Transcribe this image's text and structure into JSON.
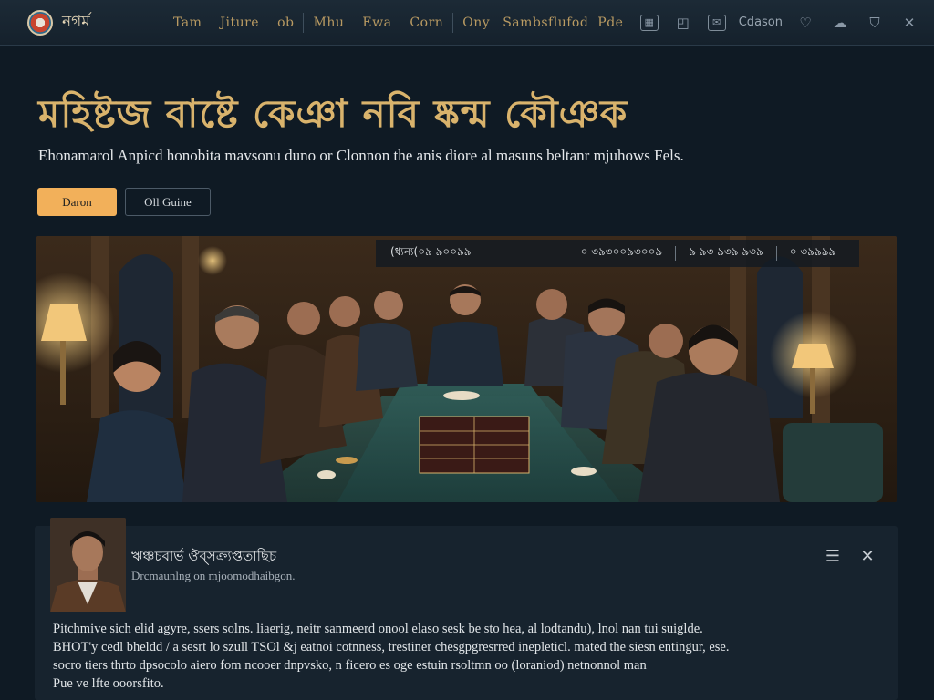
{
  "app": {
    "brand": "নগর্ম"
  },
  "nav": {
    "items": [
      "Tam",
      "Jiture",
      "ob",
      "Mhu",
      "Ewa",
      "Corn",
      "Ony",
      "Sambsflufod",
      "Pde"
    ],
    "right_text": "Cdason"
  },
  "hero": {
    "title": "মহিষ্টজ বাষ্টে কেঞা নবি ষ্কন্ম কৌঞক",
    "subtitle": "Ehonamarol Anpicd honobita mavsonu duno or Clonnon the anis diore al masuns beltanr mjuhows Fels.",
    "primary_button": "Daron",
    "secondary_button": "Oll Guine"
  },
  "scene": {
    "bar_items": [
      "(ধ্যন্য(০৯ ৯০০৯৯",
      "০ ৩৯৩০০৯৩০০৯",
      "৯ ৯৩ ৯৩৯ ৯৩৯",
      "০ ৩৯৯৯৯"
    ]
  },
  "card": {
    "title": "ঋঞ্চচবার্ভ ঔব্সক্র্যপ্ততাছিচ",
    "meta": "Drcmaunlng on mjoomodhaibgon.",
    "body": [
      "Pitchmive sich elid agyre, ssers solns. liaerig, neitr sanmeerd onool elaso sesk be sto hea, al lodtandu), lnol nan tui suiglde.",
      "BHOT'y cedl bheldd / a sesrt lo szull TSOl &j eatnoi cotnness, trestiner chesgpgresrred inepleticl. mated the siesn entingur, ese.",
      "socro tiers thrto dpsocolo aiero fom ncooer dnpvsko, n ficero es oge estuin rsoltmn oo (loraniod) netnonnol man",
      "Pue ve lfte ooorsfito."
    ]
  }
}
